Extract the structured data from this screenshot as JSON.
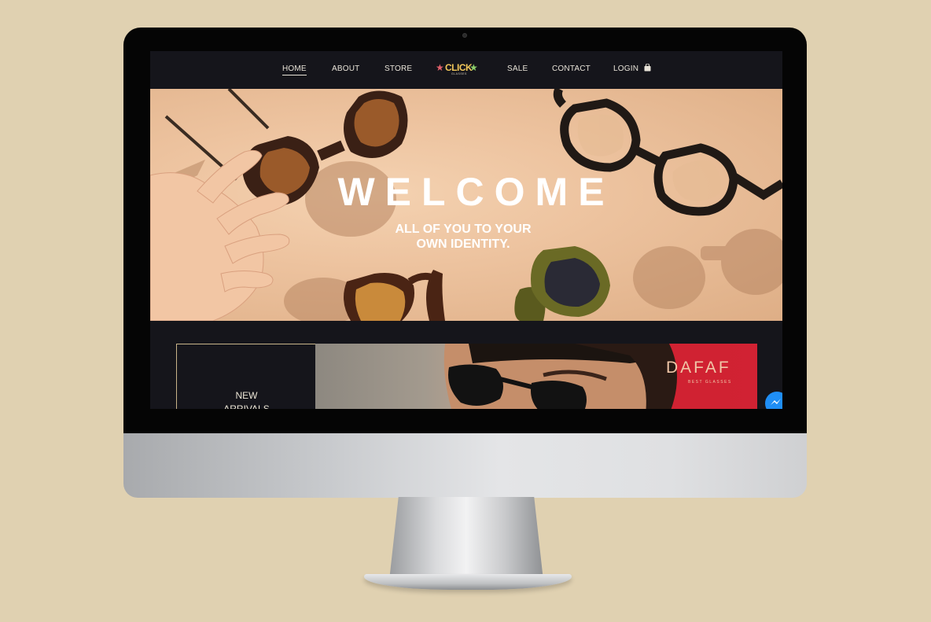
{
  "nav": {
    "items": [
      "HOME",
      "ABOUT",
      "STORE",
      "SALE",
      "CONTACT",
      "LOGIN"
    ],
    "active": "HOME",
    "logo": {
      "word": "CLICK",
      "sub": "GLASSES"
    },
    "cart_icon": "shopping-bag-icon"
  },
  "hero": {
    "title": "WELCOME",
    "subtitle_line1": "ALL OF YOU TO YOUR",
    "subtitle_line2": "OWN IDENTITY."
  },
  "promo": {
    "arrivals_line1": "NEW",
    "arrivals_line2": "ARRIVALS",
    "brand": "DAFAF",
    "brand_tagline": "BEST GLASSES"
  },
  "widgets": {
    "chat_icon": "messenger-chat-icon"
  },
  "colors": {
    "page_bg": "#e0d1b1",
    "site_bg": "#15151b",
    "accent_gold": "#c9b48a",
    "logo_yellow": "#f2c75a",
    "banner_red": "#d12233"
  }
}
